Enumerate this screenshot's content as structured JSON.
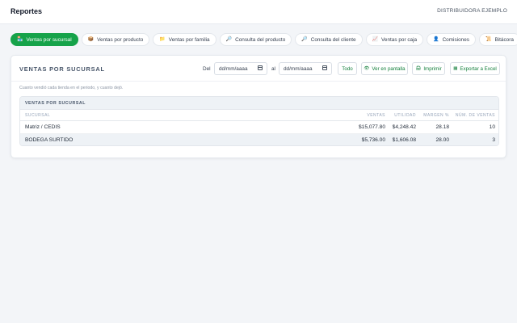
{
  "header": {
    "title": "Reportes",
    "company": "DISTRIBUIDORA EJEMPLO"
  },
  "tabs": [
    {
      "label": "Ventas por sucursal",
      "icon": "🏪",
      "active": true
    },
    {
      "label": "Ventas por producto",
      "icon": "📦",
      "active": false
    },
    {
      "label": "Ventas por familia",
      "icon": "📁",
      "active": false
    },
    {
      "label": "Consulta del producto",
      "icon": "🔎",
      "active": false
    },
    {
      "label": "Consulta del cliente",
      "icon": "🔎",
      "active": false
    },
    {
      "label": "Ventas por caja",
      "icon": "📈",
      "active": false
    },
    {
      "label": "Comisiones",
      "icon": "👤",
      "active": false
    },
    {
      "label": "Bitácora",
      "icon": "📜",
      "active": false
    }
  ],
  "report": {
    "title": "VENTAS POR SUCURSAL",
    "from_label": "Del",
    "to_label": "al",
    "date_from_placeholder": "dd/mm/aaaa",
    "date_to_placeholder": "dd/mm/aaaa",
    "all_button": "Todo",
    "screen_button": "Ver en pantalla",
    "print_button": "Imprimir",
    "excel_button": "Exportar a Excel",
    "subtitle": "Cuanto vendió cada tienda en el periodo, y cuanto dejó."
  },
  "table": {
    "caption": "VENTAS POR SUCURSAL",
    "columns": [
      "SUCURSAL",
      "VENTAS",
      "UTILIDAD",
      "MARGEN %",
      "NÚM. DE VENTAS"
    ],
    "rows": [
      {
        "sucursal": "Matriz / CEDIS",
        "ventas": "$15,077.80",
        "utilidad": "$4,248.42",
        "margen": "28.18",
        "num": "10"
      },
      {
        "sucursal": "BODEGA SURTIDO",
        "ventas": "$5,736.00",
        "utilidad": "$1,606.08",
        "margen": "28.00",
        "num": "3"
      }
    ]
  },
  "colors": {
    "accent": "#16a34a",
    "background": "#f3f5f8"
  }
}
